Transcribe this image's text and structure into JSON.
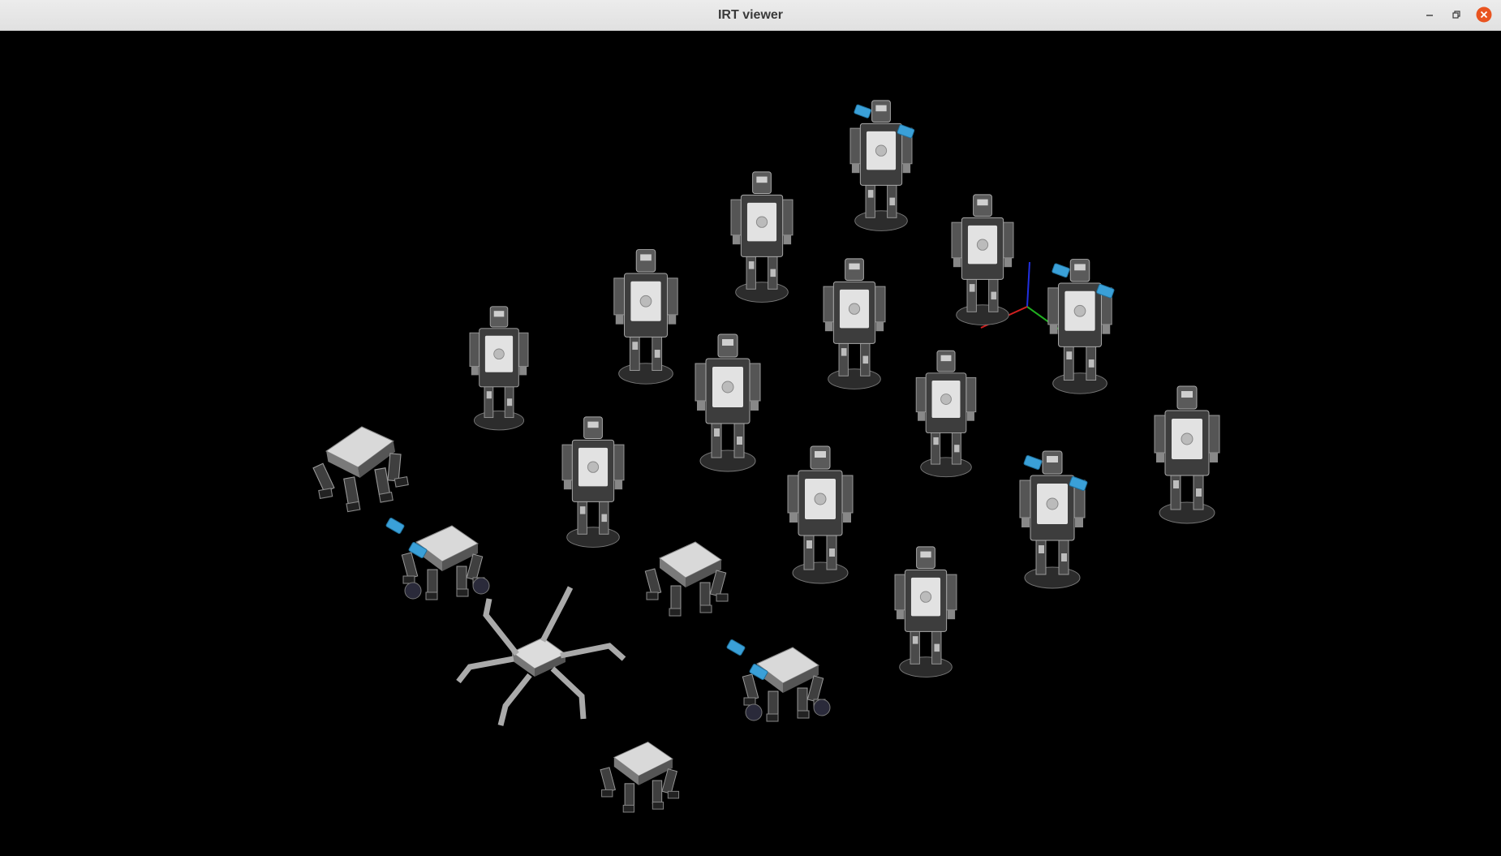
{
  "window": {
    "title": "IRT viewer",
    "controls": [
      "minimize",
      "maximize",
      "close"
    ]
  },
  "colors": {
    "titlebar": "#e4e4e4",
    "title_text": "#3a3a3a",
    "close_button": "#e95420",
    "viewport_background": "#000000",
    "robot_body": "#d8d8d8",
    "robot_dark": "#3a3a3a",
    "sensor_blue": "#3aa0d8",
    "axis_x": "#d02020",
    "axis_y": "#20b020",
    "axis_z": "#2030e0"
  },
  "scene": {
    "icons": [
      "coordinate-axes-icon",
      "humanoid-robot-icon",
      "quadruped-robot-icon",
      "hexapod-robot-icon",
      "wheeled-robot-icon"
    ]
  }
}
